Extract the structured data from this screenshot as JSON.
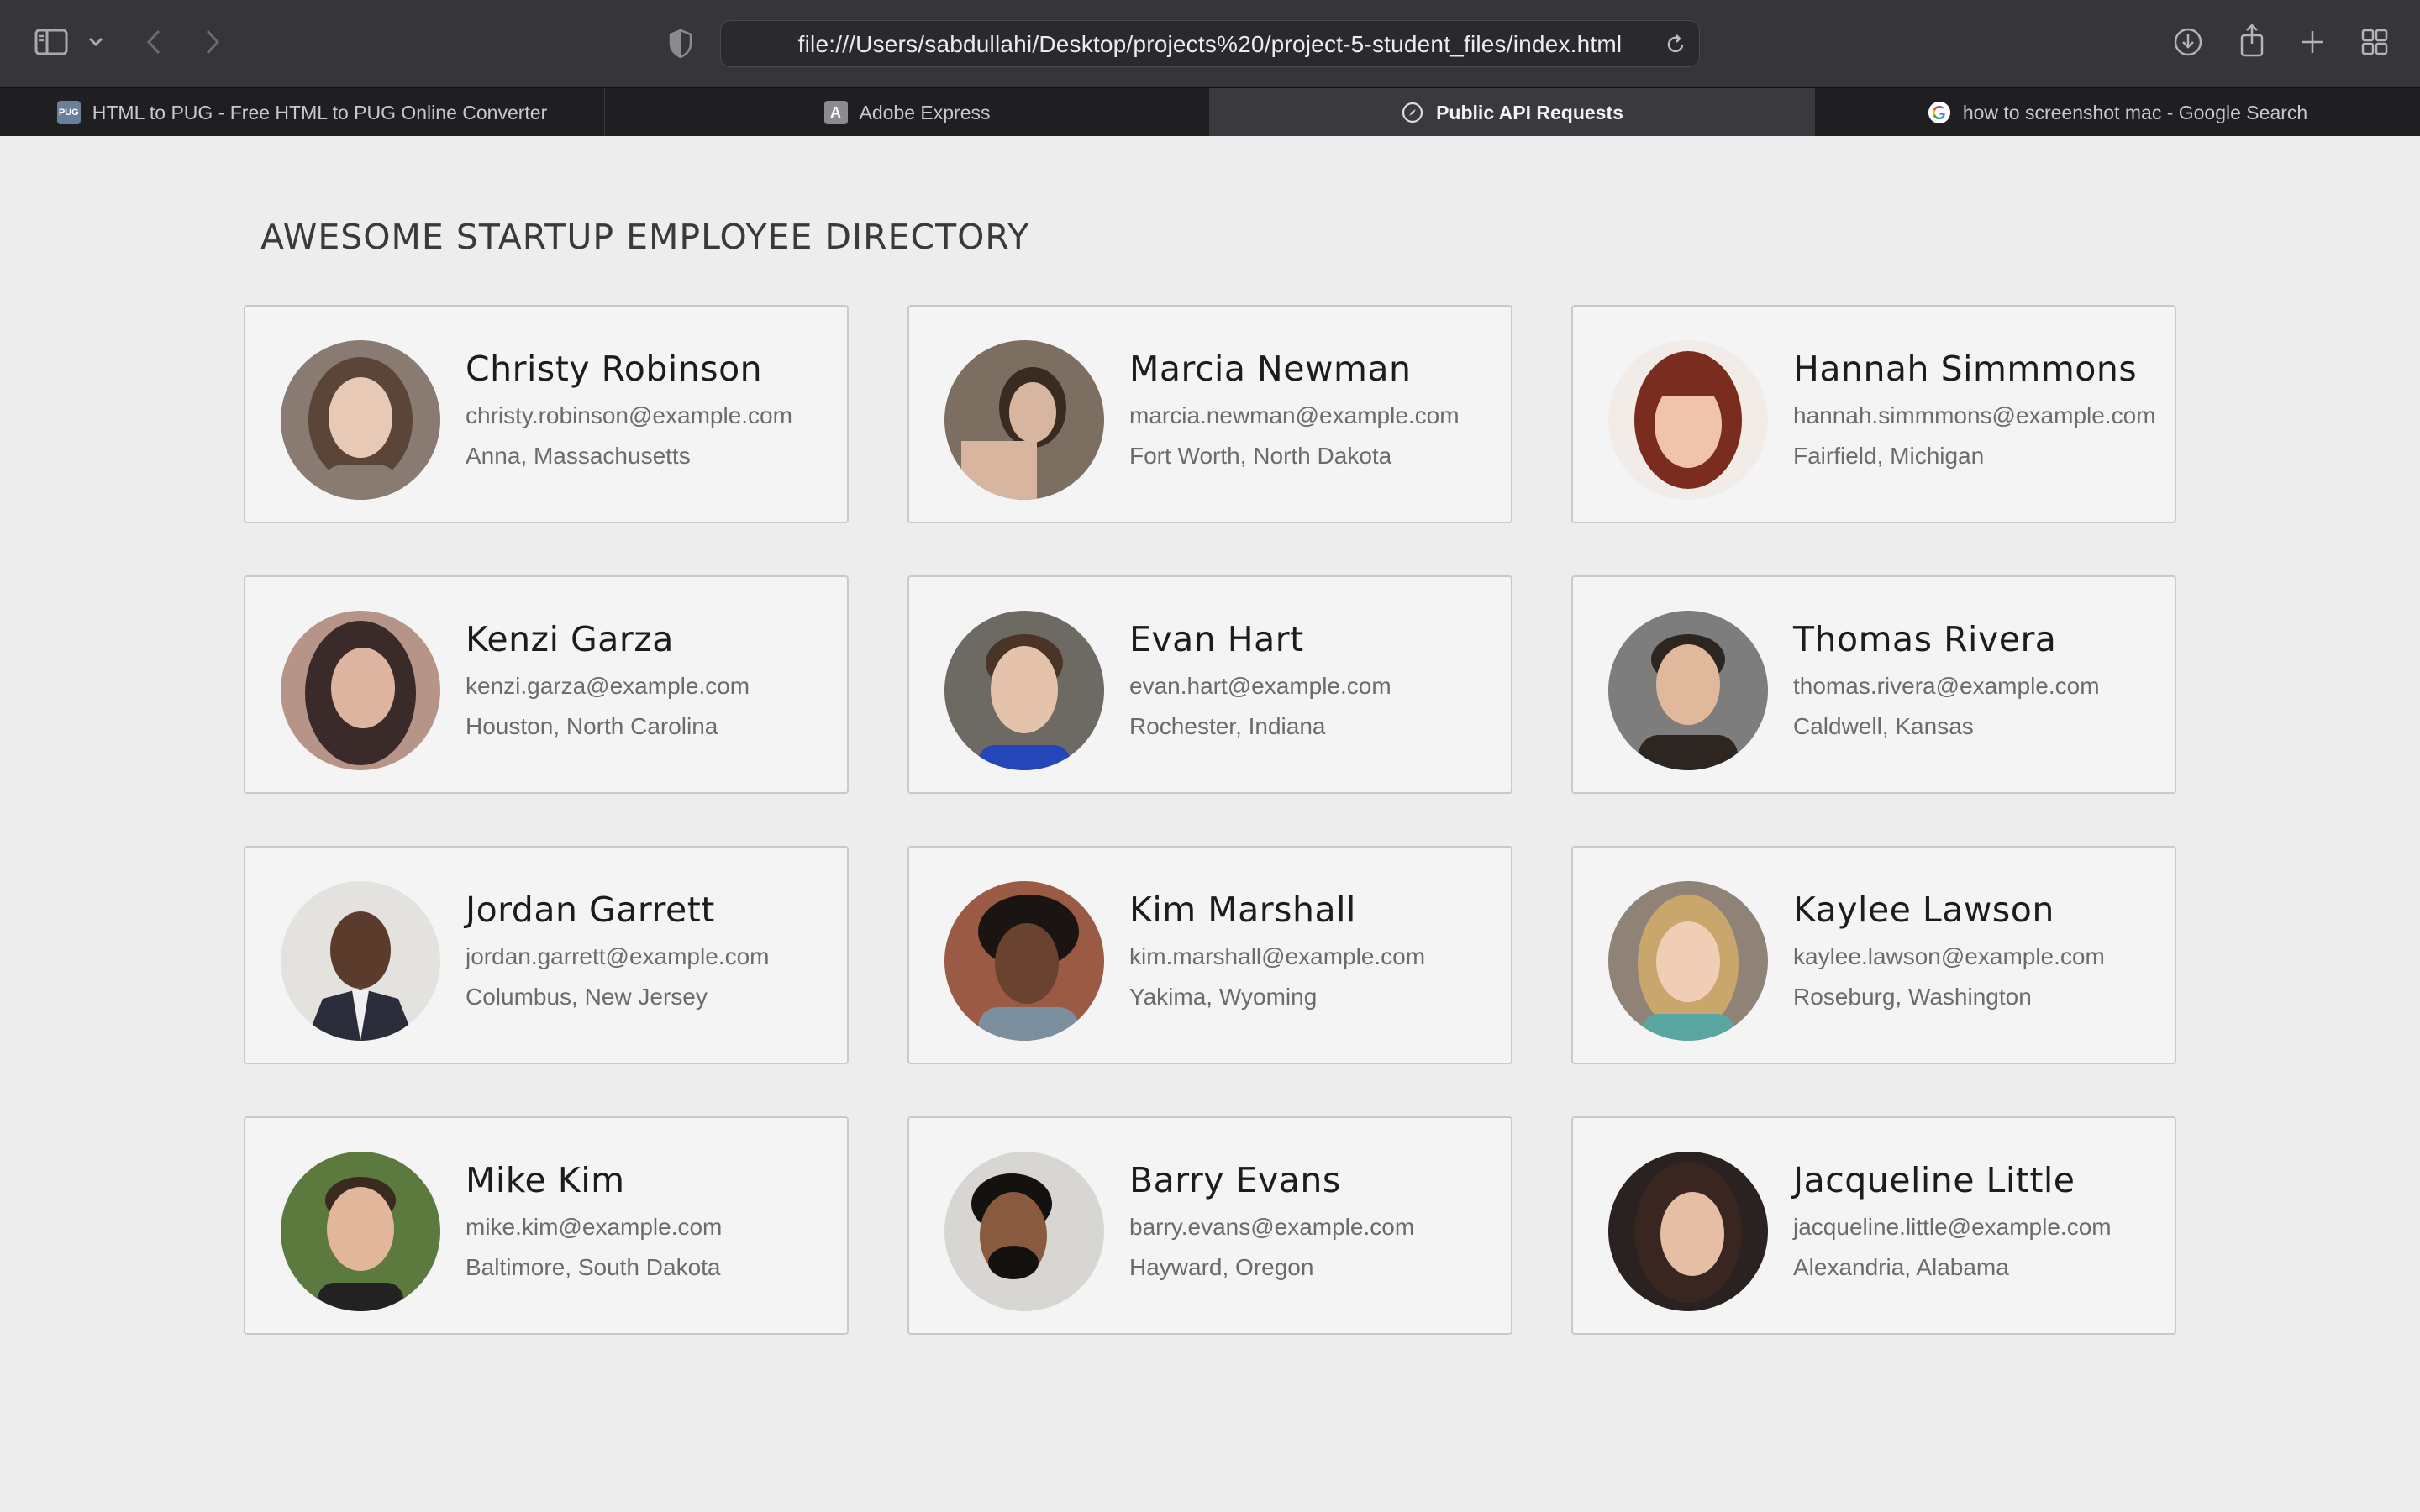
{
  "browser": {
    "url": "file:///Users/sabdullahi/Desktop/projects%20/project-5-student_files/index.html",
    "tabs": [
      {
        "label": "HTML to PUG - Free HTML to PUG Online Converter",
        "favicon": "pug-favicon",
        "active": false
      },
      {
        "label": "Adobe Express",
        "favicon": "adobe-express-favicon",
        "active": false
      },
      {
        "label": "Public API Requests",
        "favicon": "compass-favicon",
        "active": true
      },
      {
        "label": "how to screenshot mac - Google Search",
        "favicon": "google-favicon",
        "active": false
      }
    ]
  },
  "page": {
    "title": "AWESOME STARTUP EMPLOYEE DIRECTORY"
  },
  "employees": [
    {
      "name": "Christy Robinson",
      "email": "christy.robinson@example.com",
      "location": "Anna, Massachusetts",
      "photo_colors": [
        "#8a7b72",
        "#5a4538",
        "#e7c9b6"
      ]
    },
    {
      "name": "Marcia Newman",
      "email": "marcia.newman@example.com",
      "location": "Fort Worth, North Dakota",
      "photo_colors": [
        "#7c6f62",
        "#3a2b22",
        "#d8b59e"
      ]
    },
    {
      "name": "Hannah Simmmons",
      "email": "hannah.simmmons@example.com",
      "location": "Fairfield, Michigan",
      "photo_colors": [
        "#f1ece8",
        "#7a2c1e",
        "#efc4ab"
      ]
    },
    {
      "name": "Kenzi Garza",
      "email": "kenzi.garza@example.com",
      "location": "Houston, North Carolina",
      "photo_colors": [
        "#b69487",
        "#3b2a2a",
        "#dcb4a0"
      ]
    },
    {
      "name": "Evan Hart",
      "email": "evan.hart@example.com",
      "location": "Rochester, Indiana",
      "photo_colors": [
        "#6c6a63",
        "#4a3426",
        "#e4c2ac"
      ]
    },
    {
      "name": "Thomas Rivera",
      "email": "thomas.rivera@example.com",
      "location": "Caldwell, Kansas",
      "photo_colors": [
        "#7d7d7d",
        "#2d2620",
        "#e0b89c"
      ]
    },
    {
      "name": "Jordan Garrett",
      "email": "jordan.garrett@example.com",
      "location": "Columbus, New Jersey",
      "photo_colors": [
        "#e4e2de",
        "#1e1c1c",
        "#5a3b2c"
      ]
    },
    {
      "name": "Kim Marshall",
      "email": "kim.marshall@example.com",
      "location": "Yakima, Wyoming",
      "photo_colors": [
        "#9a5a43",
        "#1a1412",
        "#6a4330"
      ]
    },
    {
      "name": "Kaylee Lawson",
      "email": "kaylee.lawson@example.com",
      "location": "Roseburg, Washington",
      "photo_colors": [
        "#8f8378",
        "#c9a66c",
        "#f0cdb5"
      ]
    },
    {
      "name": "Mike Kim",
      "email": "mike.kim@example.com",
      "location": "Baltimore, South Dakota",
      "photo_colors": [
        "#5d7a3e",
        "#3a2a20",
        "#e2b69b"
      ]
    },
    {
      "name": "Barry Evans",
      "email": "barry.evans@example.com",
      "location": "Hayward, Oregon",
      "photo_colors": [
        "#d8d6d2",
        "#141210",
        "#8a5a3e"
      ]
    },
    {
      "name": "Jacqueline Little",
      "email": "jacqueline.little@example.com",
      "location": "Alexandria, Alabama",
      "photo_colors": [
        "#2a2220",
        "#3a2620",
        "#e6bea4"
      ]
    }
  ],
  "colors": {
    "toolbar_bg": "#36353a",
    "tabbar_bg": "#1f1f21",
    "page_bg": "#ededed",
    "card_bg": "#f4f4f4",
    "card_border": "#c9c9c9"
  }
}
